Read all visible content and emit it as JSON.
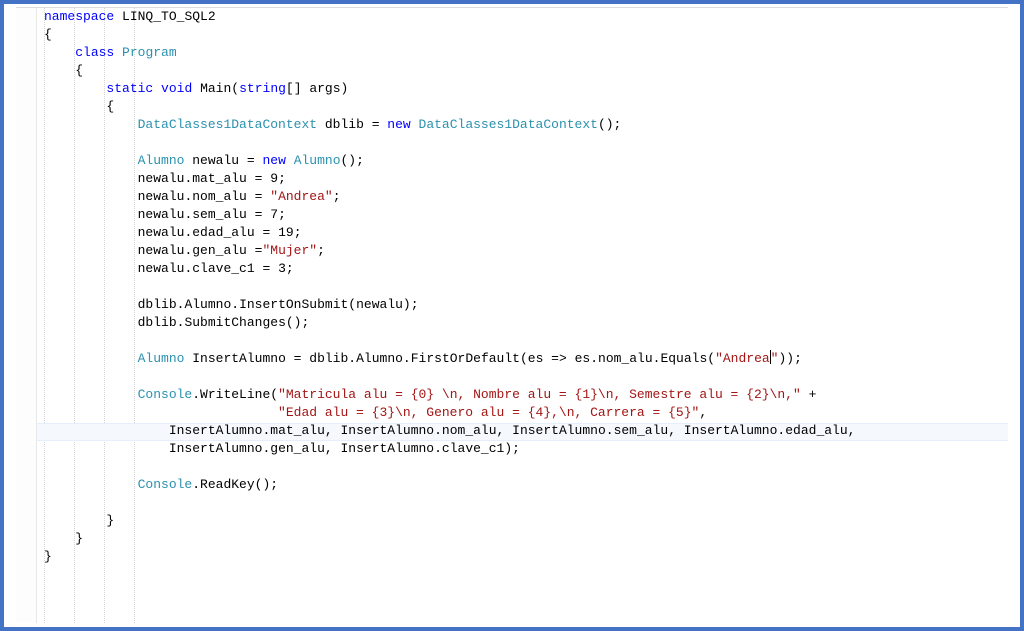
{
  "code": {
    "keywords": {
      "namespace": "namespace",
      "class": "class",
      "static": "static",
      "void": "void",
      "new": "new",
      "string": "string"
    },
    "types": {
      "Program": "Program",
      "DataContext": "DataClasses1DataContext",
      "Alumno": "Alumno",
      "Console": "Console"
    },
    "identifiers": {
      "ns_name": "LINQ_TO_SQL2",
      "main": "Main",
      "args": "args",
      "dblib": "dblib",
      "newalu": "newalu",
      "InsertAlumno": "InsertAlumno",
      "es": "es"
    },
    "members": {
      "mat_alu": "mat_alu",
      "nom_alu": "nom_alu",
      "sem_alu": "sem_alu",
      "edad_alu": "edad_alu",
      "gen_alu": "gen_alu",
      "clave_c1": "clave_c1",
      "InsertOnSubmit": "InsertOnSubmit",
      "SubmitChanges": "SubmitChanges",
      "FirstOrDefault": "FirstOrDefault",
      "Equals": "Equals",
      "WriteLine": "WriteLine",
      "ReadKey": "ReadKey"
    },
    "values": {
      "mat_alu": "9",
      "nom_alu_str": "\"Andrea\"",
      "sem_alu": "7",
      "edad_alu": "19",
      "gen_alu_str": "\"Mujer\"",
      "clave_c1": "3",
      "andrea_query_str_open": "\"Andrea",
      "andrea_query_str_close": "\"",
      "fmt1": "\"Matricula alu = {0} \\n, Nombre alu = {1}\\n, Semestre alu = {2}\\n,\"",
      "fmt2": "\"Edad alu = {3}\\n, Genero alu = {4},\\n, Carrera = {5}\""
    }
  },
  "layout": {
    "highlight_line_index": 23
  }
}
